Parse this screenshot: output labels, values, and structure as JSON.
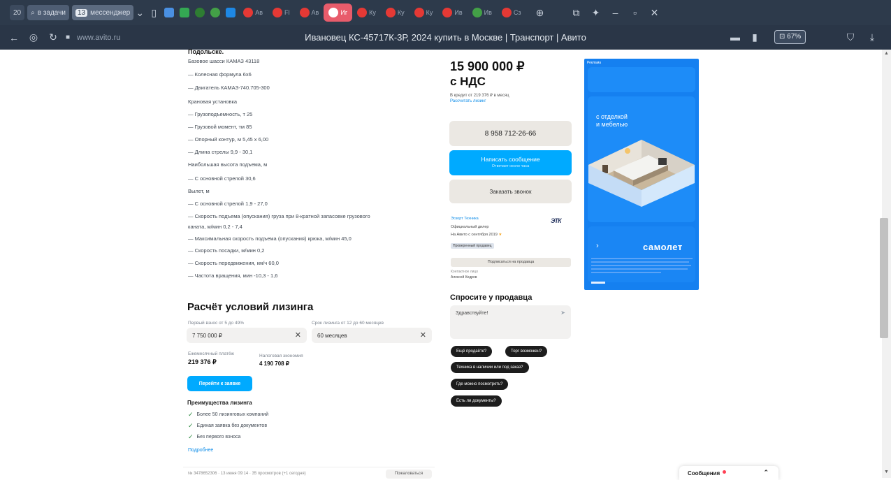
{
  "browser": {
    "tab_count": "20",
    "search_chip": "в задачи",
    "num_chip": "13",
    "num_chip_label": "мессенджер",
    "tabs": [
      {
        "label": "Ав"
      },
      {
        "label": "Fl"
      },
      {
        "label": "Ав"
      },
      {
        "label": "Иг"
      },
      {
        "label": "Ку"
      },
      {
        "label": "Ку"
      },
      {
        "label": "Ку"
      },
      {
        "label": "Ив"
      },
      {
        "label": "Ив"
      },
      {
        "label": "Сз"
      }
    ],
    "url": "www.avito.ru",
    "title": "Ивановец КС-45717К-3Р, 2024 купить в Москве | Транспорт | Авито",
    "zoom": "67%"
  },
  "description": {
    "head": "Подольске.",
    "lines": [
      "Базовое шасси КАМАЗ 43118",
      "— Колесная формула 6x6",
      "— Двигатель КАМАЗ-740.705-300",
      "Крановая установка",
      "— Грузоподъемность, т 25",
      "— Грузовой момент, тм 85",
      "— Опорный контур, м 5,45 х 6,00",
      "— Длина стрелы 9,9 - 30,1",
      "Наибольшая высота подъема, м",
      "— С основной стрелой 30,6",
      "Вылет, м",
      "— С основной стрелой 1,9 - 27,0",
      "— Скорость подъема (опускания) груза при 8-кратной запасовке грузового",
      "каната, м/мин 0,2 - 7,4",
      "— Максимальная скорость подъема (опускания) крюка, м/мин 45,0",
      "— Скорость посадки, м/мин 0,2",
      "— Скорость передвижения, км/ч 60,0",
      "— Частота вращения, мин -10,3 - 1,6"
    ]
  },
  "leasing": {
    "title": "Расчёт условий лизинга",
    "advance_label": "Первый взнос от 5 до 49%",
    "advance_value": "7 750 000 ₽",
    "term_label": "Срок лизинга от 12 до 60 месяцев",
    "term_value": "60 месяцев",
    "monthly_label": "Ежемесячный платёж",
    "monthly_value": "219 376 ₽",
    "saving_label": "Налоговая экономия",
    "saving_value": "4 190 708 ₽",
    "button": "Перейти к заявке",
    "adv_title": "Преимущества лизинга",
    "adv_items": [
      "Более 50 лизинговых компаний",
      "Единая заявка без документов",
      "Без первого взноса"
    ],
    "more": "Подробнее",
    "bottom_note": "№ 3478652306 · 13 июня 09:14 · 35 просмотров (+1 сегодня)",
    "bottom_btn": "Пожаловаться"
  },
  "offer": {
    "price": "15 900 000 ₽",
    "vat": "с НДС",
    "monthly": "В кредит от 219 376 ₽ в месяц",
    "calc_link": "Рассчитать лизинг",
    "phone": "8 958 712-26-66",
    "write_label": "Написать сообщение",
    "write_sub": "Отвечает около часа",
    "call_label": "Заказать звонок",
    "seller_name": "Эскорт Техника",
    "seller_type": "Официальный дилер",
    "seller_since": "На Авито с сентября 2019",
    "seller_badge": "Проверенный продавец",
    "seller_logo": "ЭТК",
    "all_ads": "Подписаться на продавца",
    "contact_person": "Контактное лицо",
    "contact_name": "Алексей Кедров",
    "ask_title": "Спросите у продавца",
    "ask_placeholder": "Здравствуйте!",
    "pills": [
      "Ещё продаёте?",
      "Торг возможен?",
      "Техника в наличии или под заказ?",
      "Где можно посмотреть?",
      "Есть ли документы?"
    ]
  },
  "ad": {
    "tag": "Реклама",
    "headline": [
      "с отделкой",
      "и мебелью"
    ],
    "brand": "самолет"
  },
  "messenger": {
    "label": "Сообщения"
  },
  "colors": {
    "accent": "#00aaff",
    "ad_blue": "#1580f0",
    "chrome": "#2d3a4b"
  }
}
